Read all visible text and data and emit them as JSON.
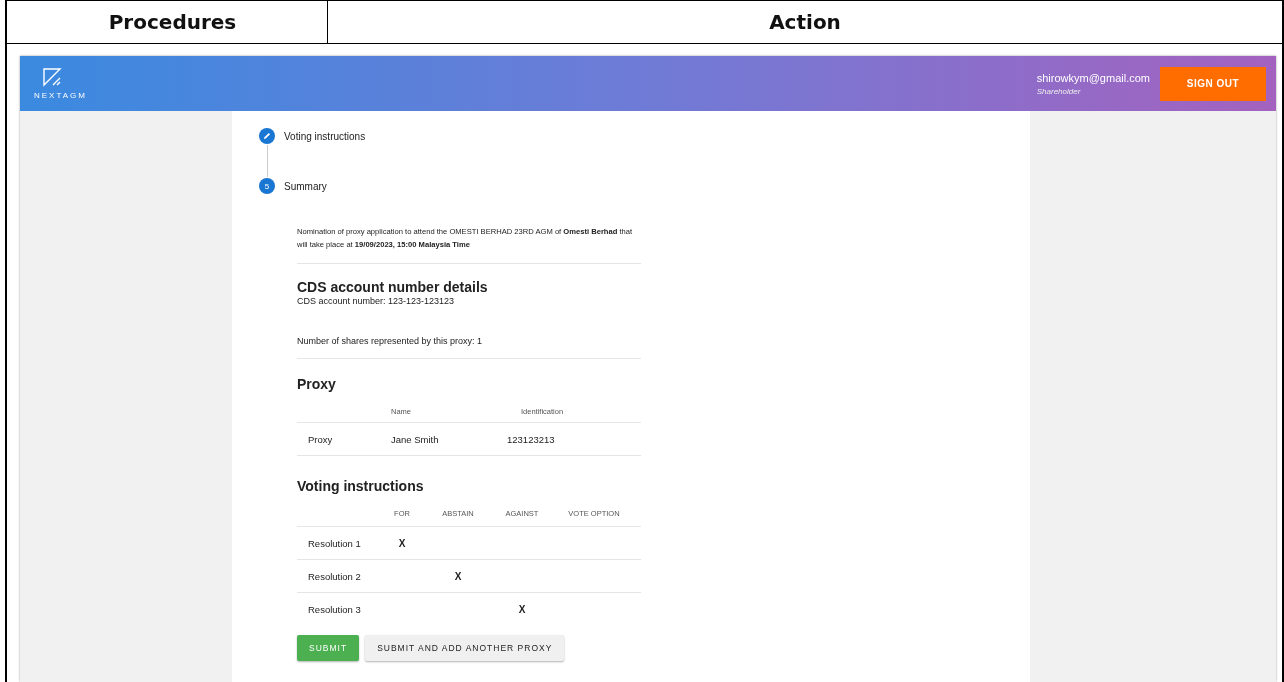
{
  "document": {
    "columns": [
      "Procedures",
      "Action"
    ]
  },
  "app": {
    "logo": "NEXTAGM",
    "email": "shirowkym@gmail.com",
    "role": "Shareholder",
    "sign_out": "SIGN OUT"
  },
  "steps": [
    {
      "kind": "done",
      "label": "Voting instructions"
    },
    {
      "kind": "active",
      "number": "5",
      "label": "Summary"
    }
  ],
  "intro": "Nomination of proxy application to attend the OMESTI BERHAD 23RD AGM of **Omesti Berhad** that will take place at **19/09/2023, 15:00 Malaysia Time**",
  "cds": {
    "title": "CDS account number details",
    "account": "CDS account number: 123-123-123123",
    "shares": "Number of shares represented by this proxy: 1"
  },
  "proxy": {
    "title": "Proxy",
    "columns": {
      "name": "Name",
      "identification": "Identification"
    },
    "rows": [
      {
        "role": "Proxy",
        "name": "Jane Smith",
        "identification": "123123213"
      }
    ]
  },
  "voting": {
    "title": "Voting instructions",
    "columns": {
      "for": "FOR",
      "abstain": "ABSTAIN",
      "against": "AGAINST",
      "vote_option": "VOTE OPTION"
    },
    "rows": [
      {
        "label": "Resolution 1",
        "for": "X"
      },
      {
        "label": "Resolution 2",
        "abstain": "X"
      },
      {
        "label": "Resolution 3",
        "against": "X"
      }
    ]
  },
  "buttons": [
    {
      "kind": "primary",
      "label": "SUBMIT"
    },
    {
      "kind": "secondary",
      "label": "SUBMIT AND ADD ANOTHER PROXY"
    }
  ]
}
